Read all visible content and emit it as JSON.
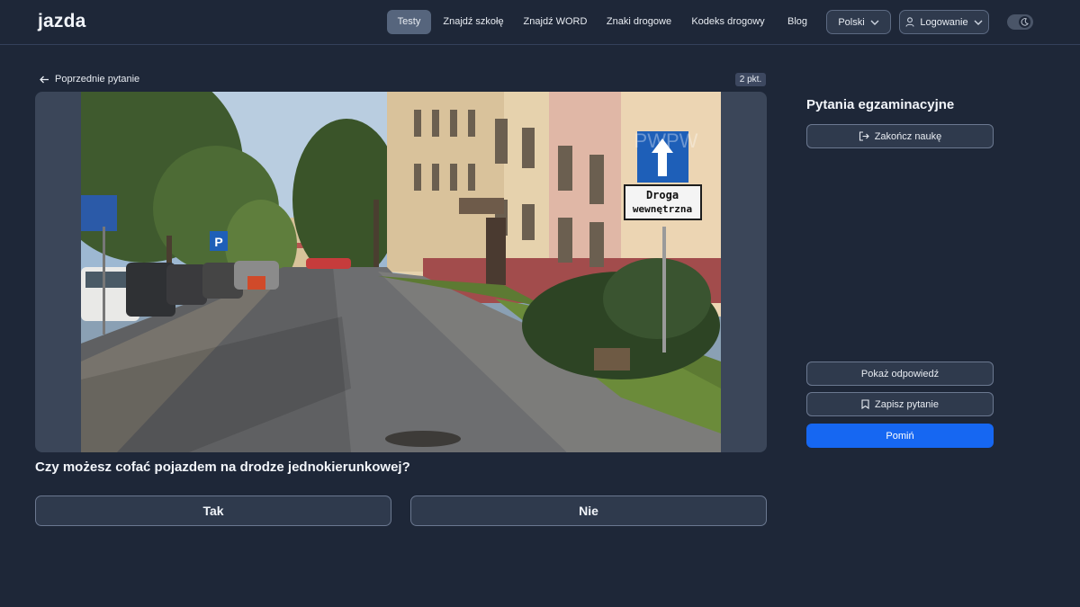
{
  "brand": {
    "logo": "jazda"
  },
  "nav": {
    "items": [
      "Testy",
      "Znajdź szkołę",
      "Znajdź WORD",
      "Znaki drogowe",
      "Kodeks drogowy",
      "Blog"
    ],
    "active": "Testy",
    "language": "Polski",
    "login": "Logowanie"
  },
  "question_panel": {
    "back_label": "Poprzednie pytanie",
    "points": "2 pkt.",
    "question": "Czy możesz cofać pojazdem na drodze jednokierunkowej?",
    "answers": [
      "Tak",
      "Nie"
    ],
    "image": {
      "sign_text_line1": "Droga",
      "sign_text_line2": "wewnętrzna",
      "watermark": "PWPW",
      "parking_sign": "P"
    }
  },
  "sidebar": {
    "title": "Pytania egzaminacyjne",
    "end_label": "Zakończ naukę",
    "show_answer_label": "Pokaż odpowiedź",
    "save_label": "Zapisz pytanie",
    "skip_label": "Pomiń"
  },
  "colors": {
    "background": "#1e2738",
    "panel": "#3b4659",
    "accent": "#1667f2",
    "active_tab": "#56657d"
  }
}
